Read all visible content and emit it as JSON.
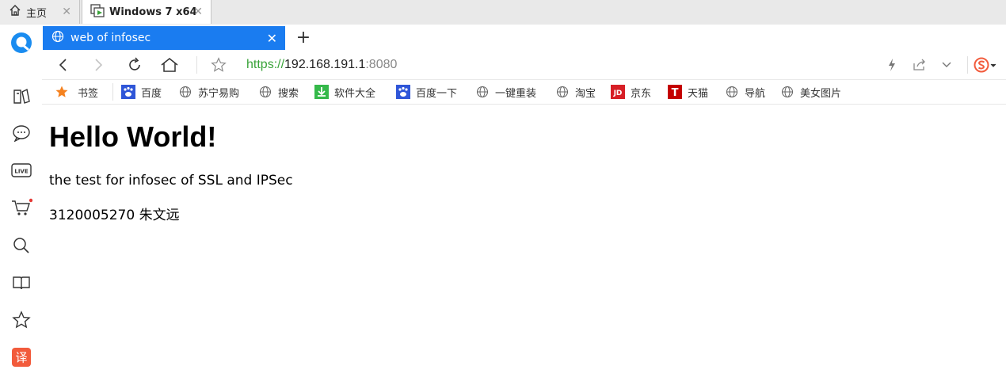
{
  "vm_tabs": {
    "home_label": "主页",
    "vm_label": "Windows 7 x64",
    "close_glyph": "✕"
  },
  "browser_tab": {
    "title": "web of infosec",
    "close_glyph": "✕",
    "new_tab_glyph": "+"
  },
  "address": {
    "scheme": "https://",
    "host": "192.168.191.1",
    "port": ":8080"
  },
  "bookmarks": [
    {
      "label": "书签",
      "icon": "star-icon"
    },
    {
      "label": "百度",
      "icon": "baidu-icon"
    },
    {
      "label": "苏宁易购",
      "icon": "globe-icon"
    },
    {
      "label": "搜索",
      "icon": "globe-icon"
    },
    {
      "label": "软件大全",
      "icon": "download-icon"
    },
    {
      "label": "百度一下",
      "icon": "baidu-icon"
    },
    {
      "label": "一键重装",
      "icon": "globe-icon"
    },
    {
      "label": "淘宝",
      "icon": "globe-icon"
    },
    {
      "label": "京东",
      "icon": "jd-icon"
    },
    {
      "label": "天猫",
      "icon": "tmall-icon"
    },
    {
      "label": "导航",
      "icon": "globe-icon"
    },
    {
      "label": "美女图片",
      "icon": "globe-icon"
    }
  ],
  "icons": {
    "jd_text": "JD",
    "tmall_text": "T",
    "live_text": "LIVE",
    "translate_text": "译"
  },
  "page": {
    "heading": "Hello World!",
    "line1": "the test for infosec of SSL and IPSec",
    "line2": "3120005270 朱文远"
  },
  "colors": {
    "tab_active": "#1a7cf0",
    "https_green": "#3aa33a",
    "accent_orange": "#f58220",
    "notification_dot": "#e53935"
  }
}
